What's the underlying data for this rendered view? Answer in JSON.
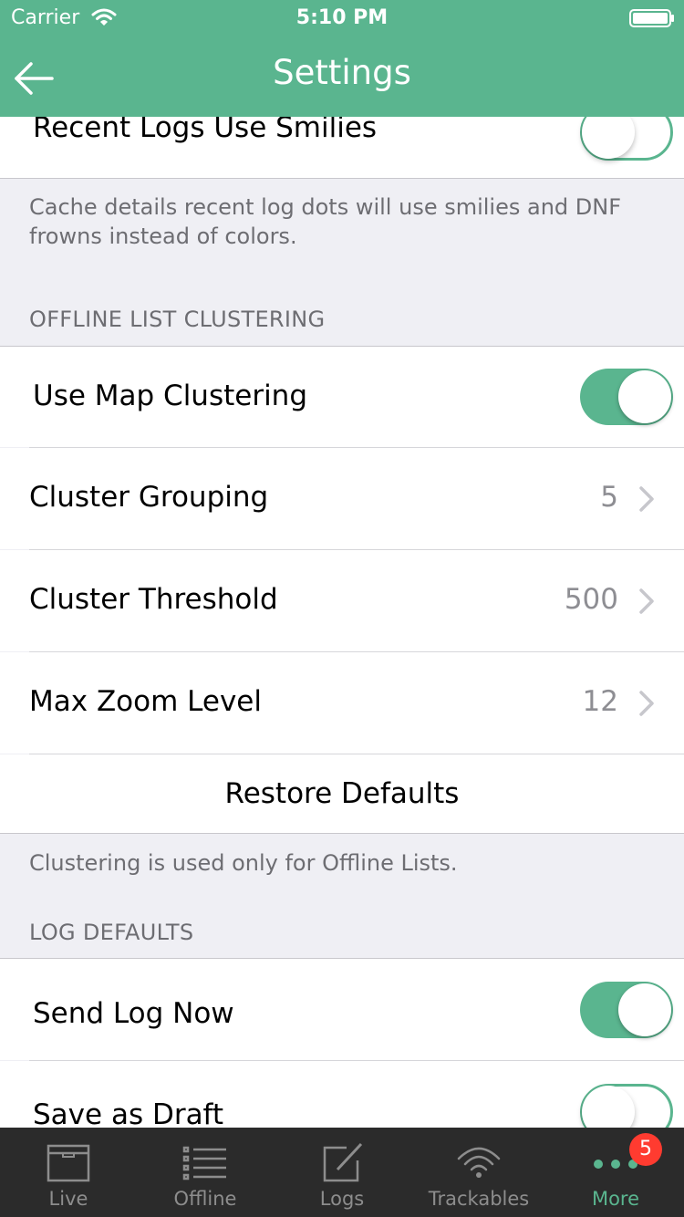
{
  "status_bar": {
    "carrier": "Carrier",
    "time": "5:10 PM"
  },
  "nav": {
    "title": "Settings",
    "back_icon": "back-arrow-icon"
  },
  "recent_logs": {
    "label": "Recent Logs Use Smilies",
    "enabled": false,
    "footer": "Cache details recent log dots will use smilies and DNF frowns instead of colors."
  },
  "offline_clustering": {
    "header": "OFFLINE LIST CLUSTERING",
    "use_map_clustering": {
      "label": "Use Map Clustering",
      "enabled": true
    },
    "cluster_grouping": {
      "label": "Cluster Grouping",
      "value": "5"
    },
    "cluster_threshold": {
      "label": "Cluster Threshold",
      "value": "500"
    },
    "max_zoom_level": {
      "label": "Max Zoom Level",
      "value": "12"
    },
    "restore_defaults": "Restore Defaults",
    "footer": "Clustering is used only for Offline Lists."
  },
  "log_defaults": {
    "header": "LOG DEFAULTS",
    "send_log_now": {
      "label": "Send Log Now",
      "enabled": true
    },
    "save_as_draft": {
      "label": "Save as Draft",
      "enabled": false
    }
  },
  "tabbar": {
    "tabs": [
      {
        "label": "Live",
        "icon": "archive-box-icon",
        "active": false
      },
      {
        "label": "Offline",
        "icon": "list-icon",
        "active": false
      },
      {
        "label": "Logs",
        "icon": "compose-icon",
        "active": false
      },
      {
        "label": "Trackables",
        "icon": "signal-icon",
        "active": false
      },
      {
        "label": "More",
        "icon": "more-dots-icon",
        "active": true
      }
    ],
    "more_badge": "5"
  },
  "colors": {
    "accent": "#5ab58f",
    "badge": "#ff3b30",
    "tabbar_bg": "#2b2b2b",
    "grouped_bg": "#efeff4"
  }
}
